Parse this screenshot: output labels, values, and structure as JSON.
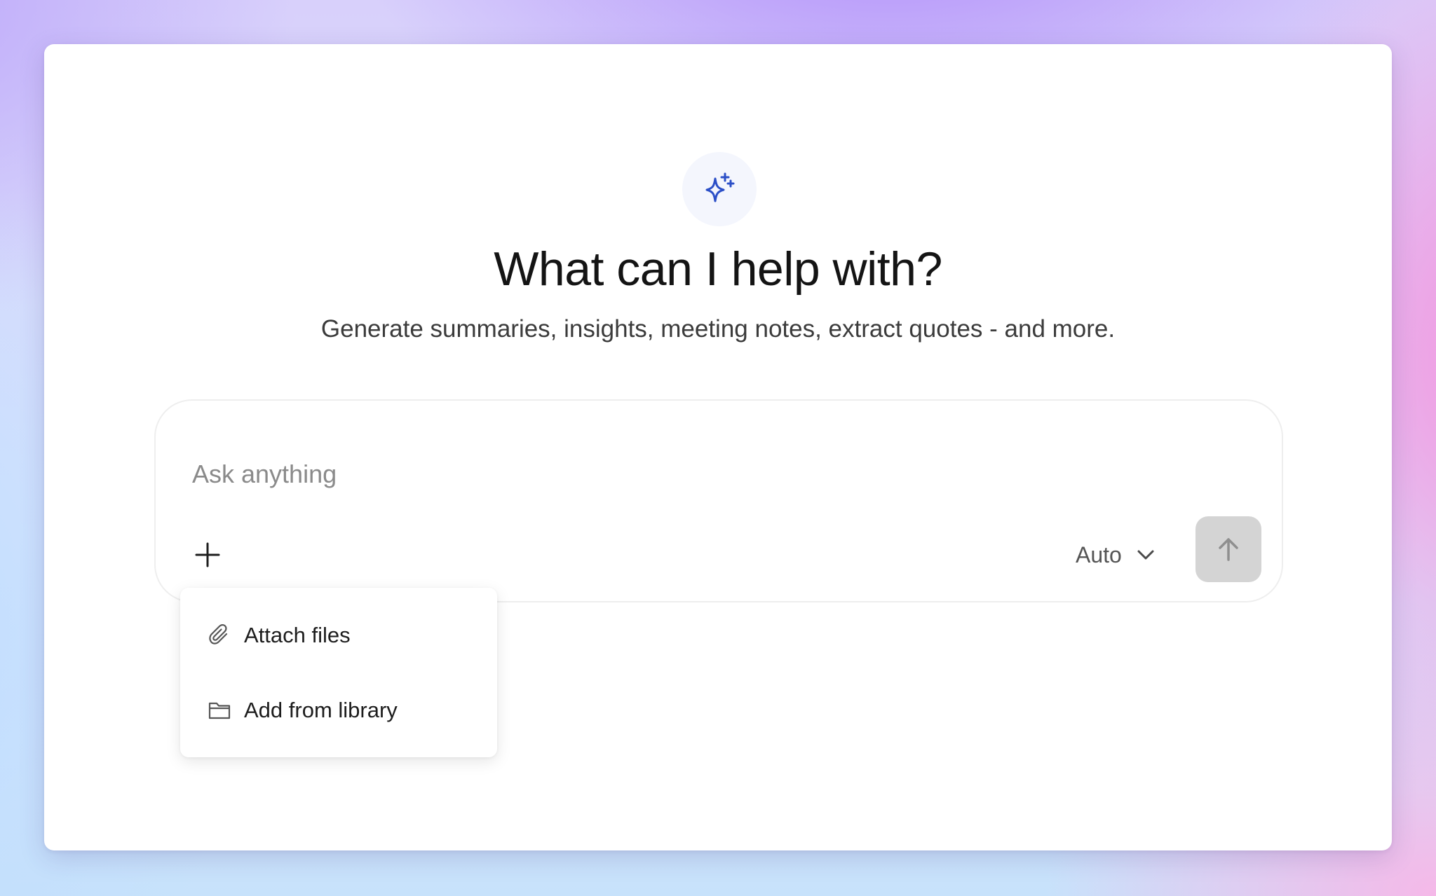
{
  "hero": {
    "icon": "sparkles-icon",
    "title": "What can I help with?",
    "subtitle": "Generate summaries, insights, meeting notes, extract quotes - and more."
  },
  "composer": {
    "placeholder": "Ask anything",
    "value": "",
    "add_icon": "plus-icon",
    "mode": {
      "selected": "Auto",
      "icon": "chevron-down-icon"
    },
    "send_icon": "arrow-up-icon"
  },
  "attach_menu": {
    "items": [
      {
        "label": "Attach files",
        "icon": "paperclip-icon"
      },
      {
        "label": "Add from library",
        "icon": "folder-icon"
      }
    ]
  },
  "colors": {
    "accent": "#2b4fc7",
    "send_button_disabled": "#d4d4d4",
    "card_background": "#ffffff"
  }
}
